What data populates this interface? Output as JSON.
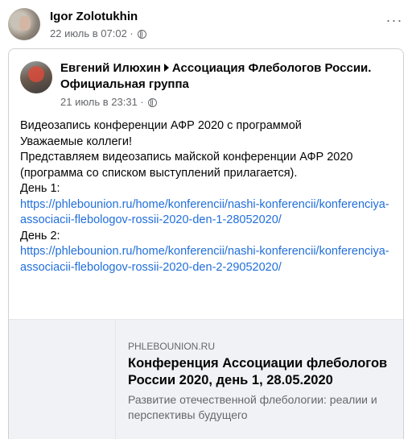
{
  "post": {
    "author": "Igor Zolotukhin",
    "meta": "22 июль в 07:02 ·",
    "more": "···"
  },
  "shared": {
    "author_part1": "Евгений Илюхин",
    "author_part2": "Ассоциация Флебологов России. Официальная группа",
    "meta": "21 июль в 23:31 ·",
    "body": {
      "line1": "Видеозапись конференции АФР 2020 с программой",
      "line2": "Уважаемые коллеги!",
      "line3": "Представляем видеозапись майской конференции АФР 2020 (программа со списком выступлений прилагается).",
      "day1_label": "День 1:",
      "day1_link": "https://phlebounion.ru/home/konferencii/nashi-konferencii/konferenciya-associacii-flebologov-rossii-2020-den-1-28052020/",
      "day2_label": "День 2:",
      "day2_link": "https://phlebounion.ru/home/konferencii/nashi-konferencii/konferenciya-associacii-flebologov-rossii-2020-den-2-29052020/"
    }
  },
  "link_preview": {
    "domain": "PHLEBOUNION.RU",
    "title": "Конференция Ассоциации флебологов России 2020, день 1, 28.05.2020",
    "description": "Развитие отечественной флебологии: реалии и перспективы будущего"
  },
  "colors": {
    "link": "#216fdb",
    "muted": "#65676b",
    "preview_bg": "#f0f2f5"
  }
}
